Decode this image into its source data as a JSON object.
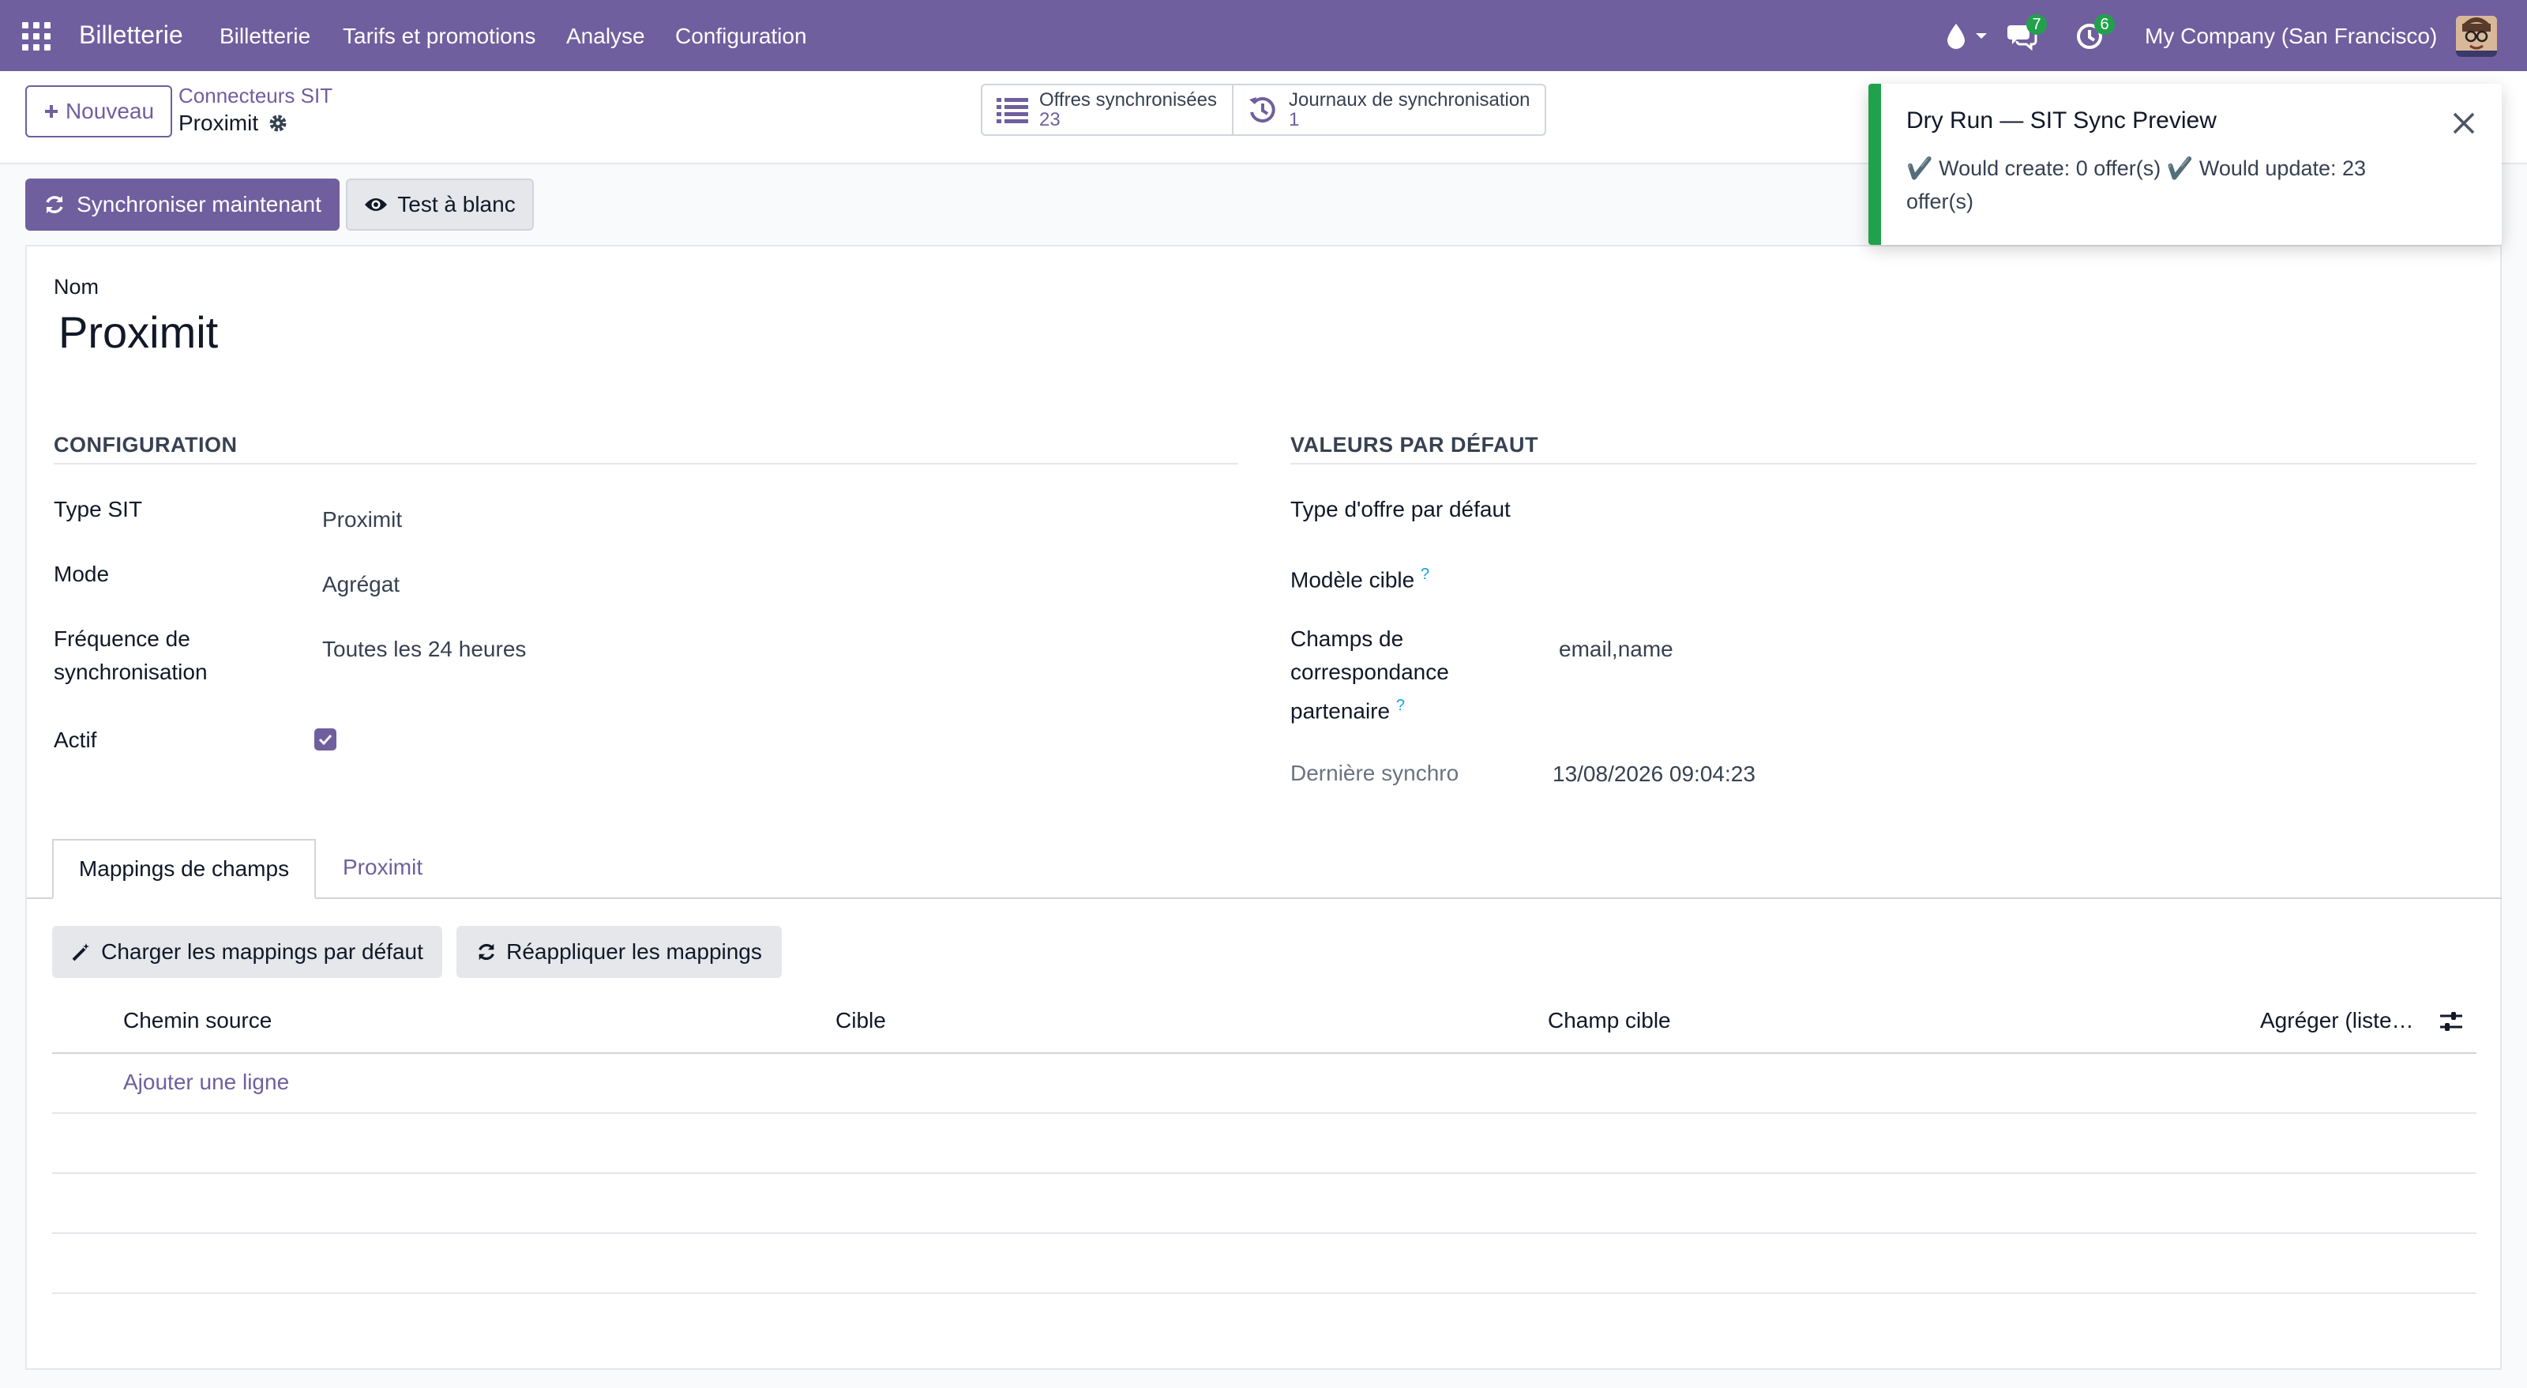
{
  "navbar": {
    "brand": "Billetterie",
    "menu": [
      "Billetterie",
      "Tarifs et promotions",
      "Analyse",
      "Configuration"
    ],
    "messages_count": "7",
    "activities_count": "6",
    "company": "My Company (San Francisco)"
  },
  "control_panel": {
    "new_button": "Nouveau",
    "breadcrumb_parent": "Connecteurs SIT",
    "breadcrumb_current": "Proximit",
    "smart_buttons": [
      {
        "label": "Offres synchronisées",
        "value": "23",
        "icon": "list-icon"
      },
      {
        "label": "Journaux de synchronisation",
        "value": "1",
        "icon": "history-icon"
      }
    ]
  },
  "actions": {
    "sync_now": "Synchroniser maintenant",
    "dry_run": "Test à blanc"
  },
  "form": {
    "name_label": "Nom",
    "name_value": "Proximit",
    "configuration": {
      "title": "CONFIGURATION",
      "type_label": "Type SIT",
      "type_value": "Proximit",
      "mode_label": "Mode",
      "mode_value": "Agrégat",
      "frequency_label_1": "Fréquence de",
      "frequency_label_2": "synchronisation",
      "frequency_value": "Toutes les 24 heures",
      "active_label": "Actif",
      "active_checked": true
    },
    "defaults": {
      "title": "VALEURS PAR DÉFAUT",
      "offer_type_label": "Type d'offre par défaut",
      "target_model_label": "Modèle cible",
      "match_fields_label_1": "Champs de",
      "match_fields_label_2": "correspondance",
      "match_fields_label_3": "partenaire",
      "match_fields_value": "email,name",
      "last_sync_label": "Dernière synchro",
      "last_sync_value": "13/08/2026 09:04:23",
      "help_mark": "?"
    }
  },
  "tabs": [
    "Mappings de champs",
    "Proximit"
  ],
  "mappings": {
    "load_defaults": "Charger les mappings par défaut",
    "reapply": "Réappliquer les mappings",
    "columns": [
      "Chemin source",
      "Cible",
      "Champ cible",
      "Agréger (liste…"
    ],
    "add_line": "Ajouter une ligne"
  },
  "toast": {
    "title": "Dry Run — SIT Sync Preview",
    "body": "✔️ Would create: 0 offer(s) ✔️ Would update: 23 offer(s)",
    "accent": "#22a14c"
  },
  "colors": {
    "brand": "#6f5f9e",
    "success": "#22a14c",
    "help": "#0ea5e9"
  }
}
